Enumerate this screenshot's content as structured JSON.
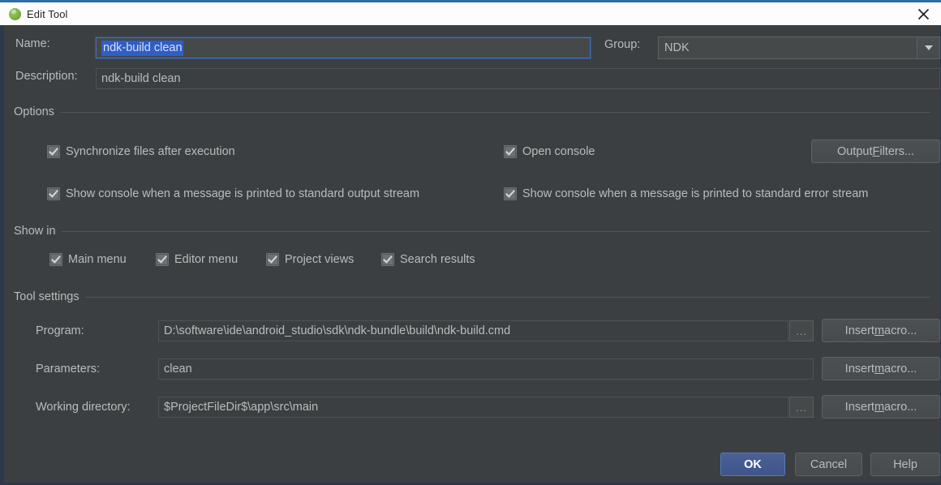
{
  "window": {
    "title": "Edit Tool",
    "app_icon": "android-studio-icon",
    "close_icon": "close-icon",
    "accent_color": "#2e6da4",
    "background_color": "#3c3f41",
    "selection_color": "#2f5ec4"
  },
  "name_row": {
    "label": "Name:",
    "value": "ndk-build clean",
    "selected": true
  },
  "group_row": {
    "label": "Group:",
    "value": "NDK"
  },
  "description_row": {
    "label": "Description:",
    "value": "ndk-build clean"
  },
  "options": {
    "title": "Options",
    "checkboxes": [
      {
        "label": "Synchronize files after execution",
        "checked": true
      },
      {
        "label": "Open console",
        "checked": true
      },
      {
        "label": "Show console when a message is printed to standard output stream",
        "checked": true
      },
      {
        "label": "Show console when a message is printed to standard error stream",
        "checked": true
      }
    ],
    "output_filters_button": {
      "prefix": "Output ",
      "mnemonic": "F",
      "suffix": "ilters..."
    }
  },
  "show_in": {
    "title": "Show in",
    "checkboxes": [
      {
        "label": "Main menu",
        "checked": true
      },
      {
        "label": "Editor menu",
        "checked": true
      },
      {
        "label": "Project views",
        "checked": true
      },
      {
        "label": "Search results",
        "checked": true
      }
    ]
  },
  "tool_settings": {
    "title": "Tool settings",
    "rows": [
      {
        "label": "Program:",
        "value": "D:\\software\\ide\\android_studio\\sdk\\ndk-bundle\\build\\ndk-build.cmd",
        "has_browse": true,
        "browse_label": "...",
        "macro_button": {
          "prefix": "Insert ",
          "mnemonic": "m",
          "suffix": "acro..."
        }
      },
      {
        "label": "Parameters:",
        "value": "clean",
        "has_browse": false,
        "browse_label": "",
        "macro_button": {
          "prefix": "Insert ",
          "mnemonic": "m",
          "suffix": "acro..."
        }
      },
      {
        "label": "Working directory:",
        "value": "$ProjectFileDir$\\app\\src\\main",
        "has_browse": true,
        "browse_label": "...",
        "macro_button": {
          "prefix": "Insert ",
          "mnemonic": "m",
          "suffix": "acro..."
        }
      }
    ]
  },
  "footer": {
    "ok": "OK",
    "cancel": "Cancel",
    "help": "Help"
  }
}
